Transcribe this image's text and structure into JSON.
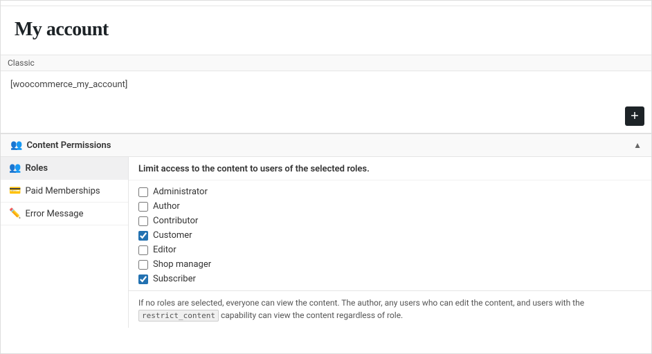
{
  "page": {
    "title": "My account"
  },
  "editor": {
    "toolbar_label": "Classic",
    "content": "[woocommerce_my_account]",
    "add_block_label": "+"
  },
  "permissions": {
    "header_label": "Content Permissions",
    "collapse_symbol": "▲",
    "description": "Limit access to the content to users of the selected roles.",
    "sidebar_items": [
      {
        "id": "roles",
        "label": "Roles",
        "icon": "👥",
        "active": true
      },
      {
        "id": "paid-memberships",
        "label": "Paid Memberships",
        "icon": "💳",
        "active": false
      },
      {
        "id": "error-message",
        "label": "Error Message",
        "icon": "✏️",
        "active": false
      }
    ],
    "roles": [
      {
        "label": "Administrator",
        "checked": false
      },
      {
        "label": "Author",
        "checked": false
      },
      {
        "label": "Contributor",
        "checked": false
      },
      {
        "label": "Customer",
        "checked": true
      },
      {
        "label": "Editor",
        "checked": false
      },
      {
        "label": "Shop manager",
        "checked": false
      },
      {
        "label": "Subscriber",
        "checked": true
      }
    ],
    "footer_note_before": "If no roles are selected, everyone can view the content. The author, any users who can edit the content, and users with the ",
    "footer_code": "restrict_content",
    "footer_note_after": " capability can view the content regardless of role."
  }
}
